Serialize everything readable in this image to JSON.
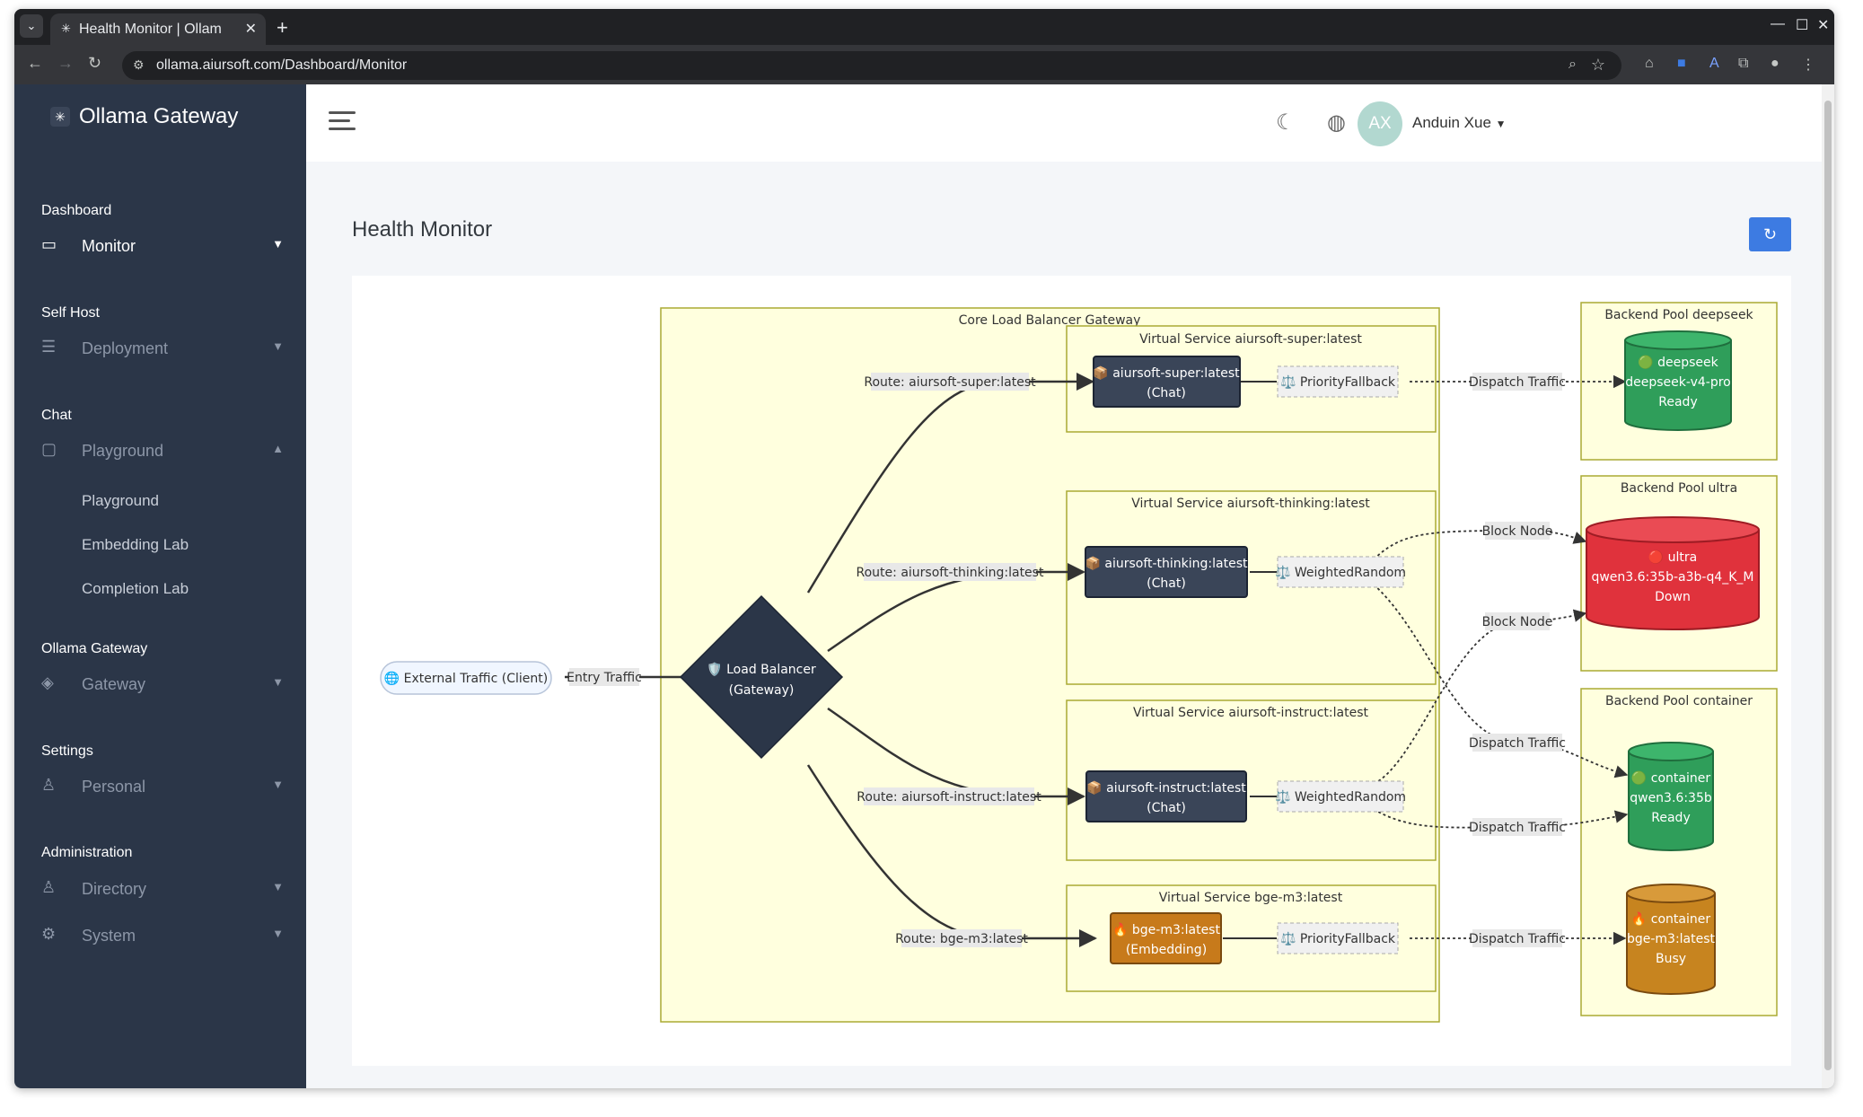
{
  "browser": {
    "tab_title": "Health Monitor | Ollam",
    "tab_favicon": "✳",
    "url": "ollama.aiursoft.com/Dashboard/Monitor"
  },
  "sidebar": {
    "brand": "Ollama Gateway",
    "sections": {
      "dashboard": "Dashboard",
      "self_host": "Self Host",
      "chat": "Chat",
      "ollama_gateway": "Ollama Gateway",
      "settings": "Settings",
      "administration": "Administration"
    },
    "items": {
      "monitor": "Monitor",
      "deployment": "Deployment",
      "playground": "Playground",
      "gateway": "Gateway",
      "personal": "Personal",
      "directory": "Directory",
      "system": "System"
    },
    "subitems": {
      "playground": "Playground",
      "embedding_lab": "Embedding Lab",
      "completion_lab": "Completion Lab"
    }
  },
  "header": {
    "avatar_initials": "AX",
    "user_name": "Anduin Xue"
  },
  "main": {
    "title": "Health Monitor"
  },
  "diagram": {
    "client": "🌐 External Traffic (Client)",
    "entry_label": "Entry Traffic",
    "lb_line1": "🛡️ Load Balancer",
    "lb_line2": "(Gateway)",
    "core_title": "Core Load Balancer Gateway",
    "vs_super_title": "Virtual Service aiursoft-super:latest",
    "vs_thinking_title": "Virtual Service aiursoft-thinking:latest",
    "vs_instruct_title": "Virtual Service aiursoft-instruct:latest",
    "vs_bge_title": "Virtual Service bge-m3:latest",
    "route_super": "Route: aiursoft-super:latest",
    "route_thinking": "Route: aiursoft-thinking:latest",
    "route_instruct": "Route: aiursoft-instruct:latest",
    "route_bge": "Route: bge-m3:latest",
    "model_super_1": "📦 aiursoft-super:latest",
    "model_super_2": "(Chat)",
    "model_thinking_1": "📦 aiursoft-thinking:latest",
    "model_thinking_2": "(Chat)",
    "model_instruct_1": "📦 aiursoft-instruct:latest",
    "model_instruct_2": "(Chat)",
    "model_bge_1": "🔥 bge-m3:latest",
    "model_bge_2": "(Embedding)",
    "strategy_priority": "⚖️ PriorityFallback",
    "strategy_weighted": "⚖️ WeightedRandom",
    "dispatch_label": "Dispatch Traffic",
    "block_label": "Block Node",
    "pool_deepseek_title": "Backend Pool deepseek",
    "pool_ultra_title": "Backend Pool ultra",
    "pool_container_title": "Backend Pool container",
    "node_deepseek_1": "🟢 deepseek",
    "node_deepseek_2": "deepseek-v4-pro",
    "node_deepseek_3": "Ready",
    "node_ultra_1": "🔴 ultra",
    "node_ultra_2": "qwen3.6:35b-a3b-q4_K_M",
    "node_ultra_3": "Down",
    "node_c1_1": "🟢 container",
    "node_c1_2": "qwen3.6:35b",
    "node_c1_3": "Ready",
    "node_c2_1": "🔥 container",
    "node_c2_2": "bge-m3:latest",
    "node_c2_3": "Busy"
  },
  "colors": {
    "sidebar_bg": "#2b3648",
    "cluster_fill": "#ffffde",
    "cluster_stroke": "#aaaa33",
    "model_fill": "#3a4558",
    "embedding_fill": "#c77a1b",
    "ready_fill": "#2f9e5a",
    "down_fill": "#e0323c",
    "busy_fill": "#c7841f",
    "accent": "#3d7be2"
  },
  "icons": {
    "monitor": "monitor-icon",
    "deployment": "server-icon",
    "playground": "chat-icon",
    "gateway": "layers-icon",
    "personal": "user-icon",
    "directory": "users-icon",
    "system": "gear-icon",
    "theme": "moon-icon",
    "language": "globe-icon",
    "refresh": "refresh-icon"
  }
}
